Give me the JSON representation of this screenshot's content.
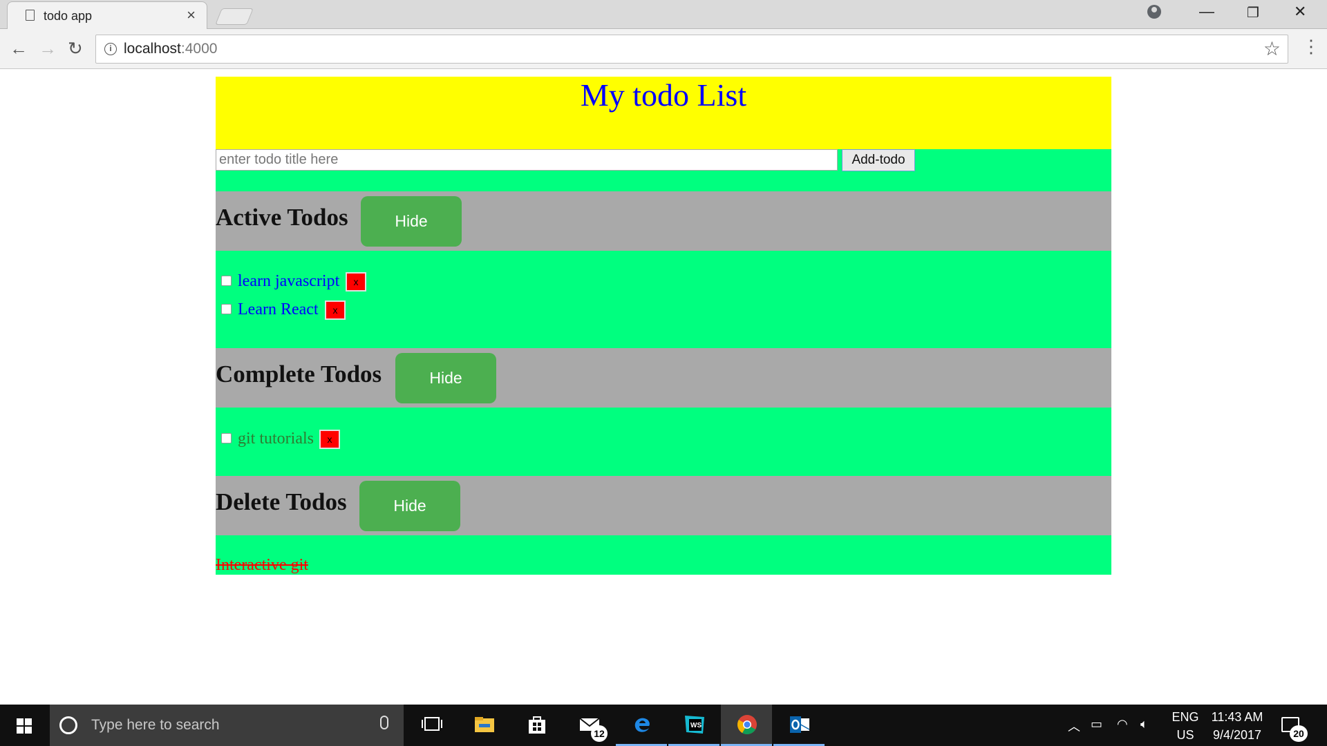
{
  "browser": {
    "tab_title": "todo app",
    "url_host": "localhost",
    "url_port": ":4000"
  },
  "app": {
    "title": "My todo List",
    "input_placeholder": "enter todo title here",
    "add_button": "Add-todo",
    "sections": {
      "active": {
        "title": "Active Todos",
        "button": "Hide",
        "items": [
          {
            "label": "learn javascript",
            "delete": "x"
          },
          {
            "label": "Learn React",
            "delete": "x"
          }
        ]
      },
      "complete": {
        "title": "Complete Todos",
        "button": "Hide",
        "items": [
          {
            "label": "git tutorials",
            "delete": "x"
          }
        ]
      },
      "deleted": {
        "title": "Delete Todos",
        "button": "Hide",
        "items": [
          {
            "label": "Interactive git"
          }
        ]
      }
    },
    "colors": {
      "header_bg": "#ffff00",
      "list_bg": "#00ff7f",
      "section_bg": "#a9a9a9",
      "hide_button": "#4caf50",
      "delete_button": "#ff0000",
      "title_text": "#0000ff"
    }
  },
  "taskbar": {
    "search_placeholder": "Type here to search",
    "mail_badge": "12",
    "language_primary": "ENG",
    "language_region": "US",
    "time": "11:43 AM",
    "date": "9/4/2017",
    "notification_count": "20",
    "icons": [
      "windows-start-icon",
      "cortana-icon",
      "microphone-icon",
      "task-view-icon",
      "file-explorer-icon",
      "store-icon",
      "mail-icon",
      "edge-icon",
      "webstorm-icon",
      "chrome-icon",
      "outlook-icon"
    ]
  }
}
